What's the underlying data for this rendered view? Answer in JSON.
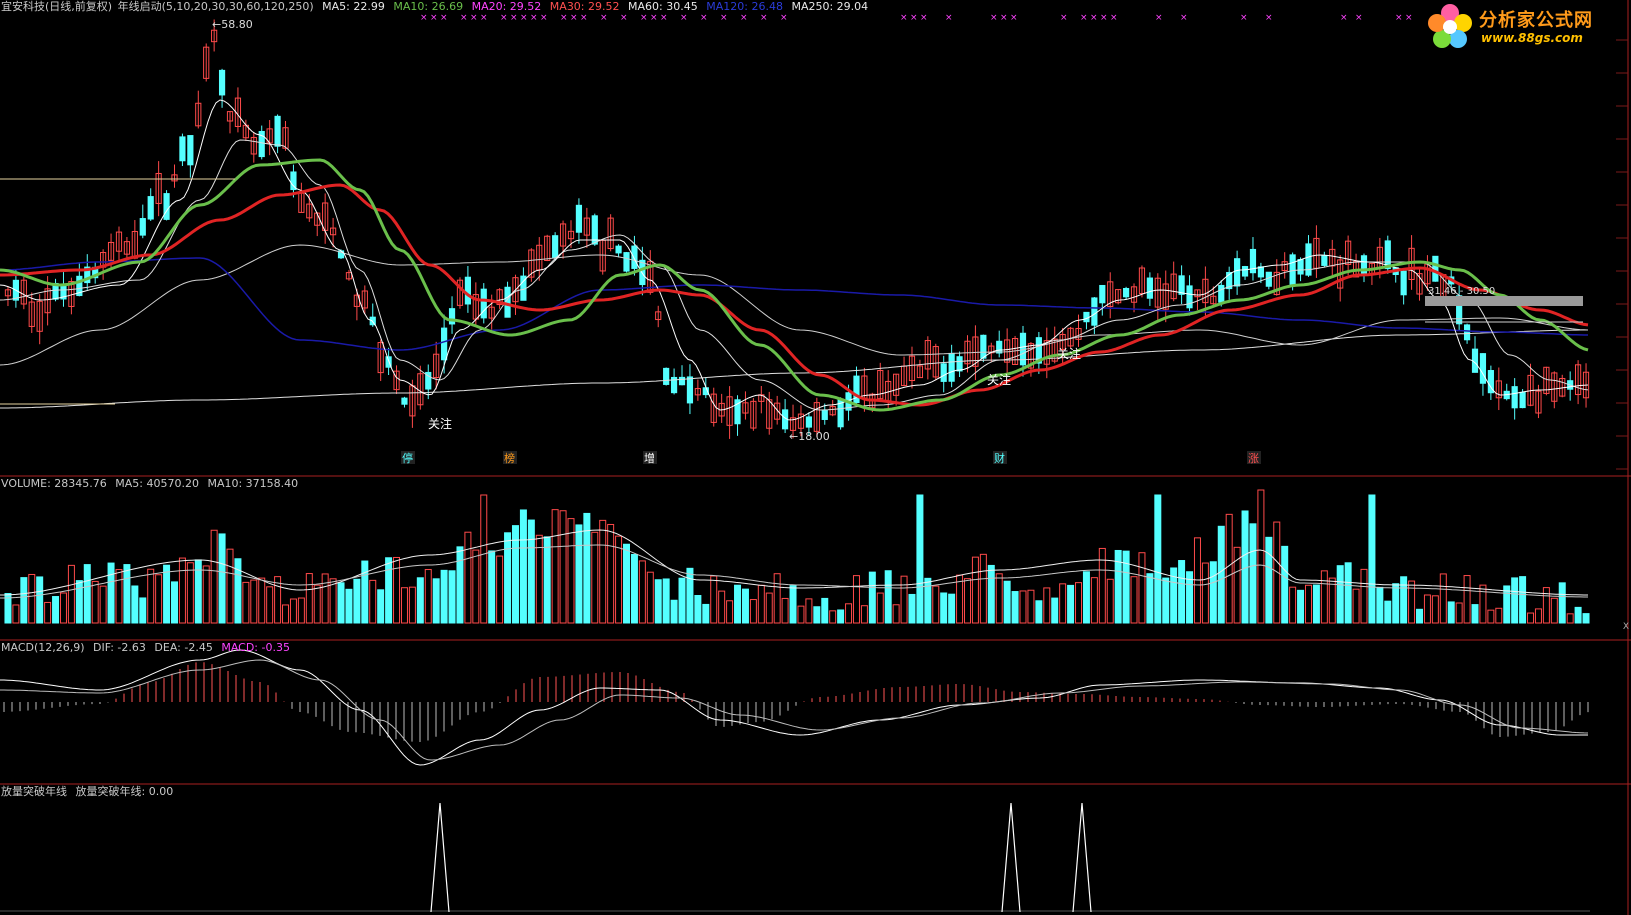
{
  "price_header": {
    "name": "宜安科技(日线,前复权)",
    "indicator": "年线启动(5,10,20,30,30,60,120,250)",
    "ma5": "MA5: 22.99",
    "ma10": "MA10: 26.69",
    "ma20": "MA20: 29.52",
    "ma30": "MA30: 29.52",
    "ma60": "MA60: 30.45",
    "ma120": "MA120: 26.48",
    "ma250": "MA250: 29.04"
  },
  "volume_header": {
    "title": "VOLUME: 28345.76",
    "ma5": "MA5: 40570.20",
    "ma10": "MA10: 37158.40"
  },
  "macd_header": {
    "title": "MACD(12,26,9)",
    "dif": "DIF: -2.63",
    "dea": "DEA: -2.45",
    "macd": "MACD: -0.35"
  },
  "signal_header": {
    "title": "放量突破年线",
    "value": "放量突破年线: 0.00"
  },
  "annotations": {
    "high": "58.80",
    "low": "18.00",
    "box": "31.46 - 30.50",
    "focus1": "关注",
    "focus2": "关注",
    "focus3": "关注"
  },
  "markers": [
    "停",
    "榜",
    "增",
    "财",
    "涨"
  ],
  "logo": {
    "name": "分析家公式网",
    "url": "www.88gs.com"
  },
  "close_glyph": "X",
  "colors": {
    "up": "#ff4a4a",
    "down": "#54ffff",
    "ma5": "#ffffff",
    "ma10": "#dddddd",
    "ma20": "#6abf4b",
    "ma30": "#e02424",
    "ma60": "#1a1aa8",
    "ma120": "#cfcfcf",
    "separator": "#a82020",
    "macd_pos": "#ff5555",
    "macd_neg": "#bbbbbb",
    "magenta": "#ff44ff"
  },
  "chart_data": {
    "type": "candlestick",
    "price_high": 58.8,
    "price_low": 18.0,
    "candle_count": 200,
    "volume_last": 28345.76,
    "macd": {
      "dif": -2.63,
      "dea": -2.45,
      "macd": -0.35
    },
    "signal_last": 0.0
  }
}
